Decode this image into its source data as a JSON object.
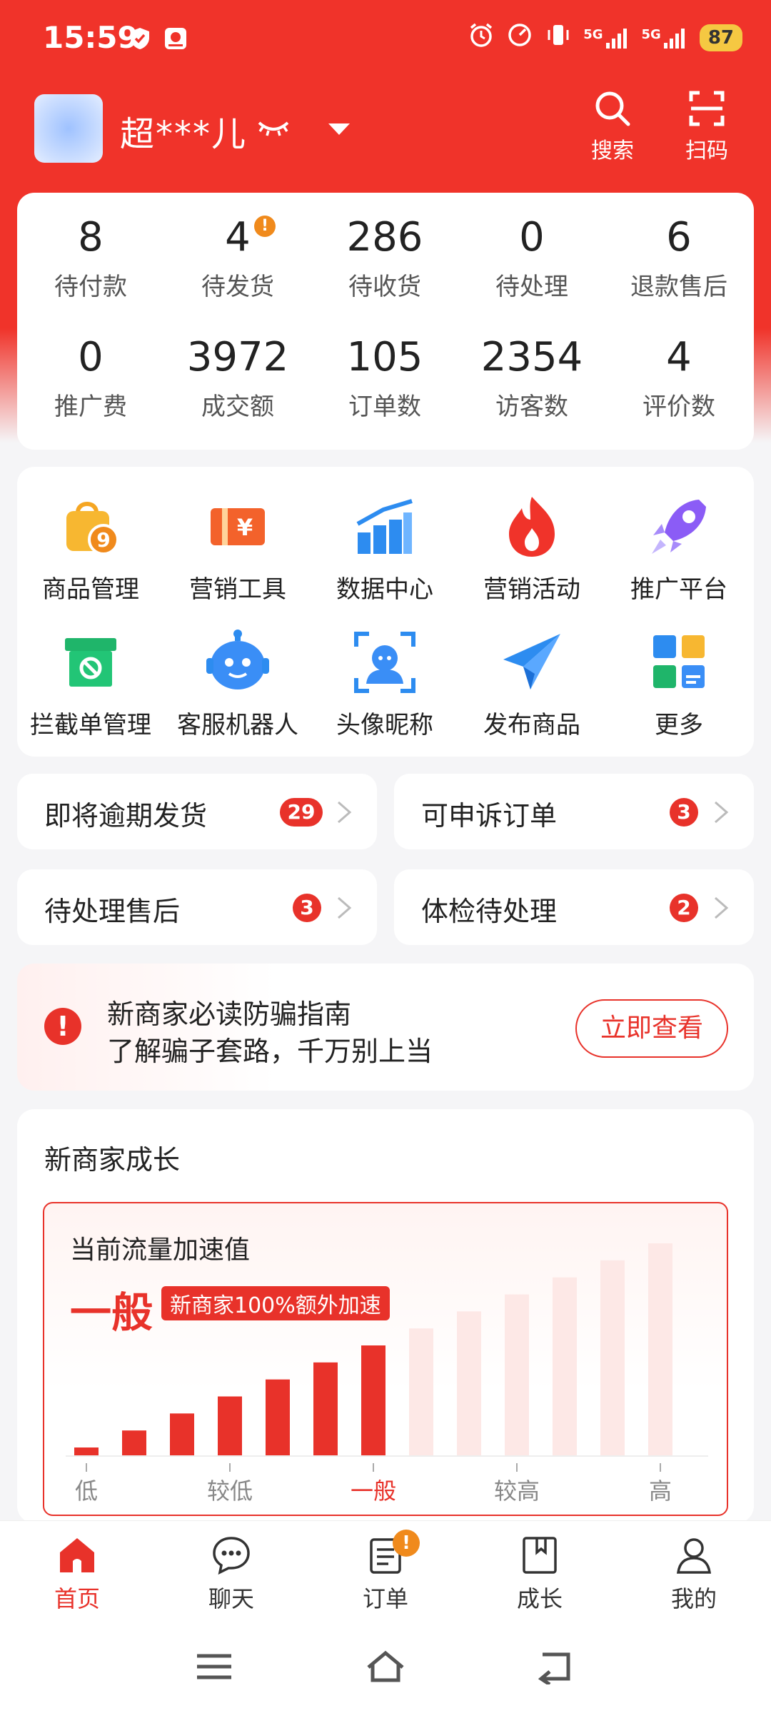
{
  "status_bar": {
    "time": "15:59",
    "network_1": "5G",
    "network_2": "5G",
    "battery": "87"
  },
  "header": {
    "shop_name": "超***儿",
    "search_label": "搜索",
    "scan_label": "扫码"
  },
  "stats": [
    {
      "value": "8",
      "label": "待付款"
    },
    {
      "value": "4",
      "label": "待发货",
      "alert": "!"
    },
    {
      "value": "286",
      "label": "待收货"
    },
    {
      "value": "0",
      "label": "待处理"
    },
    {
      "value": "6",
      "label": "退款售后"
    },
    {
      "value": "0",
      "label": "推广费"
    },
    {
      "value": "3972",
      "label": "成交额"
    },
    {
      "value": "105",
      "label": "订单数"
    },
    {
      "value": "2354",
      "label": "访客数"
    },
    {
      "value": "4",
      "label": "评价数"
    }
  ],
  "tools": [
    {
      "label": "商品管理",
      "icon": "shopping-bag-icon",
      "badge": "9"
    },
    {
      "label": "营销工具",
      "icon": "coupon-icon",
      "badge": "¥"
    },
    {
      "label": "数据中心",
      "icon": "bar-chart-icon"
    },
    {
      "label": "营销活动",
      "icon": "flame-icon"
    },
    {
      "label": "推广平台",
      "icon": "rocket-icon"
    },
    {
      "label": "拦截单管理",
      "icon": "blocked-box-icon"
    },
    {
      "label": "客服机器人",
      "icon": "robot-icon"
    },
    {
      "label": "头像昵称",
      "icon": "face-scan-icon"
    },
    {
      "label": "发布商品",
      "icon": "paper-plane-icon"
    },
    {
      "label": "更多",
      "icon": "more-apps-icon"
    }
  ],
  "todos": [
    {
      "label": "即将逾期发货",
      "count": "29"
    },
    {
      "label": "可申诉订单",
      "count": "3"
    },
    {
      "label": "待处理售后",
      "count": "3"
    },
    {
      "label": "体检待处理",
      "count": "2"
    }
  ],
  "notice": {
    "title": "新商家必读防骗指南",
    "subtitle": "了解骗子套路，千万别上当",
    "button": "立即查看",
    "icon_text": "!"
  },
  "growth": {
    "title": "新商家成长",
    "box_title": "当前流量加速值",
    "level": "一般",
    "tag": "新商家100%额外加速",
    "scale_labels": [
      "低",
      "较低",
      "一般",
      "较高",
      "高"
    ],
    "current_level_index": 2,
    "bar_levels": [
      1,
      2,
      3,
      4,
      5,
      6,
      7,
      8,
      9,
      10,
      11,
      12,
      13
    ],
    "active_bars": 7,
    "active_color": "#e8322a",
    "inactive_color": "#fde8e6"
  },
  "bottom_nav": [
    {
      "label": "首页",
      "icon": "home-icon",
      "active": true
    },
    {
      "label": "聊天",
      "icon": "chat-icon"
    },
    {
      "label": "订单",
      "icon": "order-icon",
      "badge": "!"
    },
    {
      "label": "成长",
      "icon": "bookmark-book-icon"
    },
    {
      "label": "我的",
      "icon": "profile-icon"
    }
  ],
  "colors": {
    "brand_red": "#f0332a",
    "accent_orange": "#f08a1c"
  }
}
